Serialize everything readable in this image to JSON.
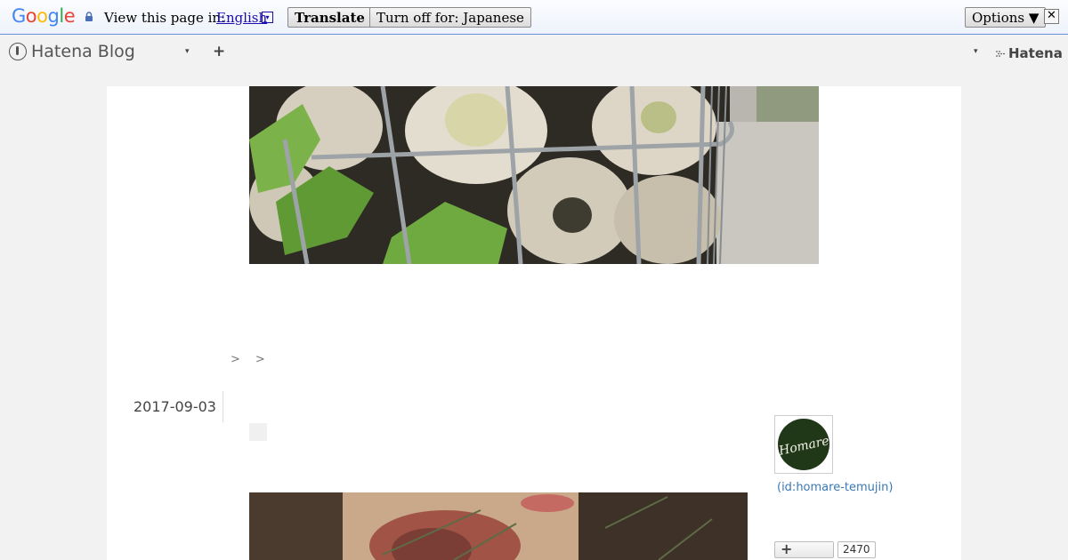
{
  "translate_bar": {
    "logo": [
      "G",
      "o",
      "o",
      "g",
      "l",
      "e"
    ],
    "logo_colors": [
      "#4285f4",
      "#ea4335",
      "#fbbc05",
      "#4285f4",
      "#34a853",
      "#ea4335"
    ],
    "prompt": "View this page in:",
    "language": "English",
    "dropdown_glyph": "▾",
    "translate_label": "Translate",
    "turn_off_label": "Turn off for: Japanese",
    "options_label": "Options ▼",
    "close_glyph": "✕"
  },
  "hatena_nav": {
    "blog_logo_text": "Hatena Blog",
    "caret": "▾",
    "plus": "+",
    "hatena_label": "Hatena"
  },
  "breadcrumb": [
    ">",
    ">"
  ],
  "article": {
    "date": "2017-09-03"
  },
  "profile": {
    "avatar_text": "Homare",
    "id": "(id:homare-temujin)"
  },
  "subscribe": {
    "plus": "+",
    "count": "2470"
  }
}
